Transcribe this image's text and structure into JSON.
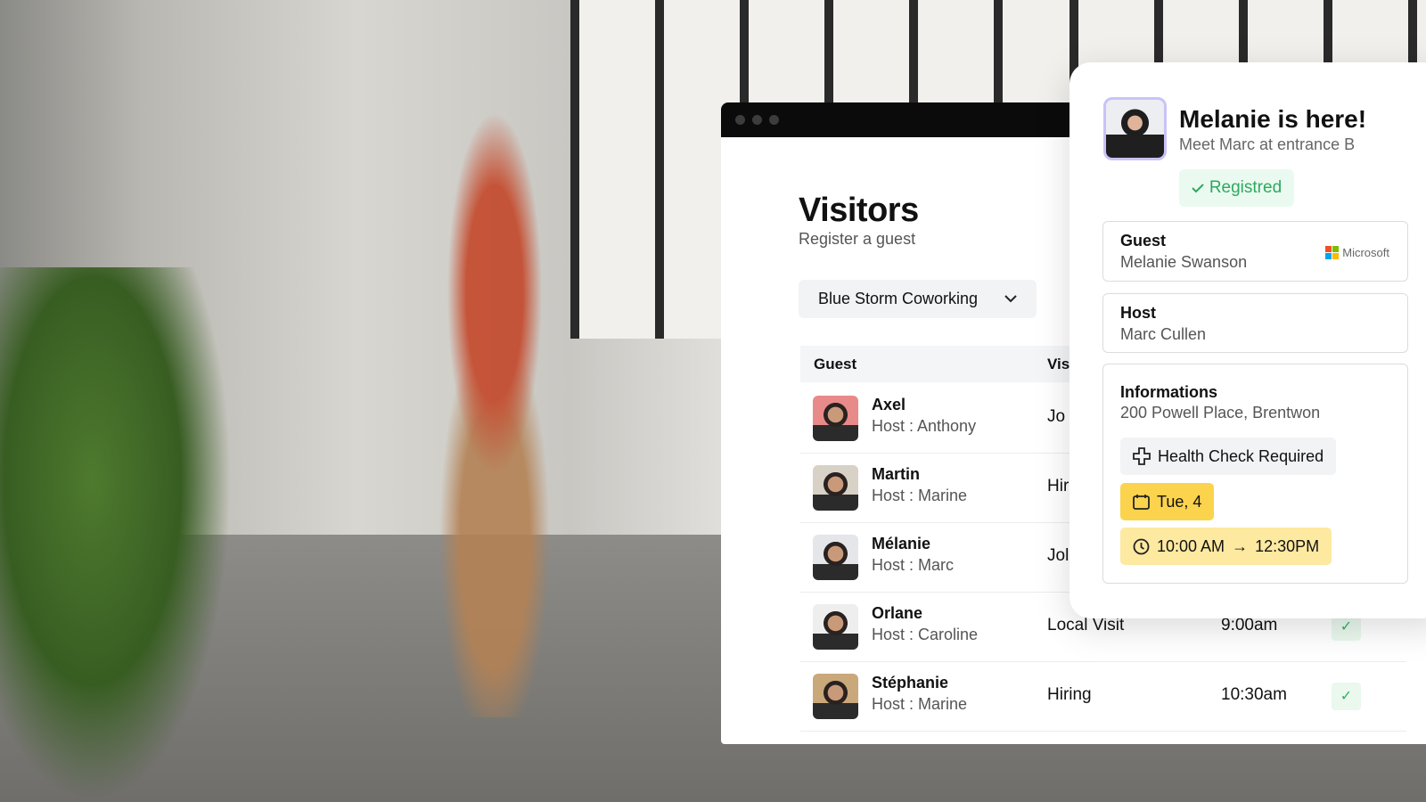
{
  "window": {
    "controls": [
      "close",
      "minimize",
      "maximize"
    ]
  },
  "page": {
    "title": "Visitors",
    "subtitle": "Register a guest",
    "location_select": "Blue Storm Coworking"
  },
  "table": {
    "headers": [
      "Guest",
      "Vis"
    ],
    "rows": [
      {
        "name": "Axel",
        "host": "Host : Anthony",
        "visit": "Jo",
        "time": "",
        "checked": false,
        "avatar_color": "#e98a8a"
      },
      {
        "name": "Martin",
        "host": "Host : Marine",
        "visit": "Hir",
        "time": "",
        "checked": false,
        "avatar_color": "#d8d2c6"
      },
      {
        "name": "Mélanie",
        "host": "Host : Marc",
        "visit": "Jol",
        "time": "",
        "checked": false,
        "avatar_color": "#e4e6ea"
      },
      {
        "name": "Orlane",
        "host": "Host : Caroline",
        "visit": "Local Visit",
        "time": "9:00am",
        "checked": true,
        "avatar_color": "#eeeeee"
      },
      {
        "name": "Stéphanie",
        "host": "Host : Marine",
        "visit": "Hiring",
        "time": "10:30am",
        "checked": true,
        "avatar_color": "#c9a87a"
      }
    ]
  },
  "notification": {
    "title": "Melanie is here!",
    "subtitle": "Meet Marc at entrance B",
    "status": "Registred",
    "guest": {
      "label": "Guest",
      "value": "Melanie Swanson",
      "company": "Microsoft"
    },
    "host": {
      "label": "Host",
      "value": "Marc Cullen"
    },
    "info": {
      "label": "Informations",
      "address": "200 Powell Place, Brentwon",
      "health": "Health Check Required",
      "date": "Tue, 4",
      "time_start": "10:00 AM",
      "time_end": "12:30PM"
    }
  },
  "colors": {
    "success": "#2fa860",
    "date_pill": "#fcd34d",
    "time_pill": "#fde9a0",
    "avatar_border": "#c9c3f7"
  }
}
